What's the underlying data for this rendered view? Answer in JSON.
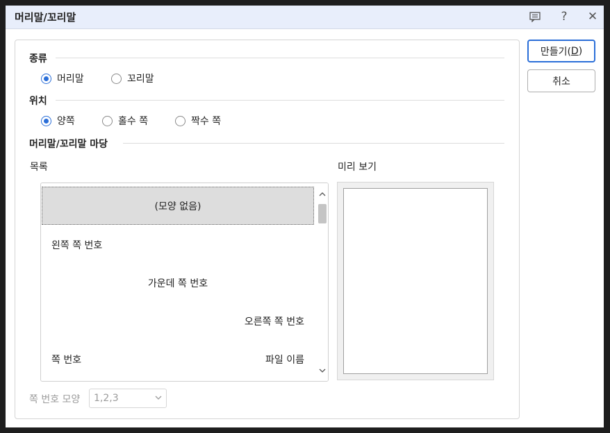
{
  "window": {
    "title": "머리말/꼬리말"
  },
  "titlebar_icons": [
    "comment-icon",
    "help-icon",
    "close-icon"
  ],
  "titlebar_glyphs": {
    "help": "?",
    "close": "✕"
  },
  "kind": {
    "label": "종류",
    "options": [
      {
        "label": "머리말",
        "checked": true
      },
      {
        "label": "꼬리말",
        "checked": false
      }
    ]
  },
  "position": {
    "label": "위치",
    "options": [
      {
        "label": "양쪽",
        "checked": true
      },
      {
        "label": "홀수 쪽",
        "checked": false
      },
      {
        "label": "짝수 쪽",
        "checked": false
      }
    ]
  },
  "gallery": {
    "label": "머리말/꼬리말 마당",
    "list_label": "목록",
    "preview_label": "미리 보기",
    "items": [
      {
        "text": "(모양 없음)",
        "selected": true
      },
      {
        "text": "왼쪽 쪽 번호"
      },
      {
        "text": "가운데 쪽 번호"
      },
      {
        "text": "오른쪽 쪽 번호"
      },
      {
        "left": "쪽 번호",
        "right": "파일 이름"
      }
    ]
  },
  "page_number_format": {
    "label": "쪽 번호 모양",
    "value": "1,2,3"
  },
  "buttons": {
    "create": {
      "text": "만들기(",
      "mnemonic": "D",
      "close": ")"
    },
    "cancel": "취소"
  },
  "colors": {
    "accent": "#2a6ed8",
    "titlebar": "#e8eefb",
    "selected_row": "#dddddd"
  }
}
